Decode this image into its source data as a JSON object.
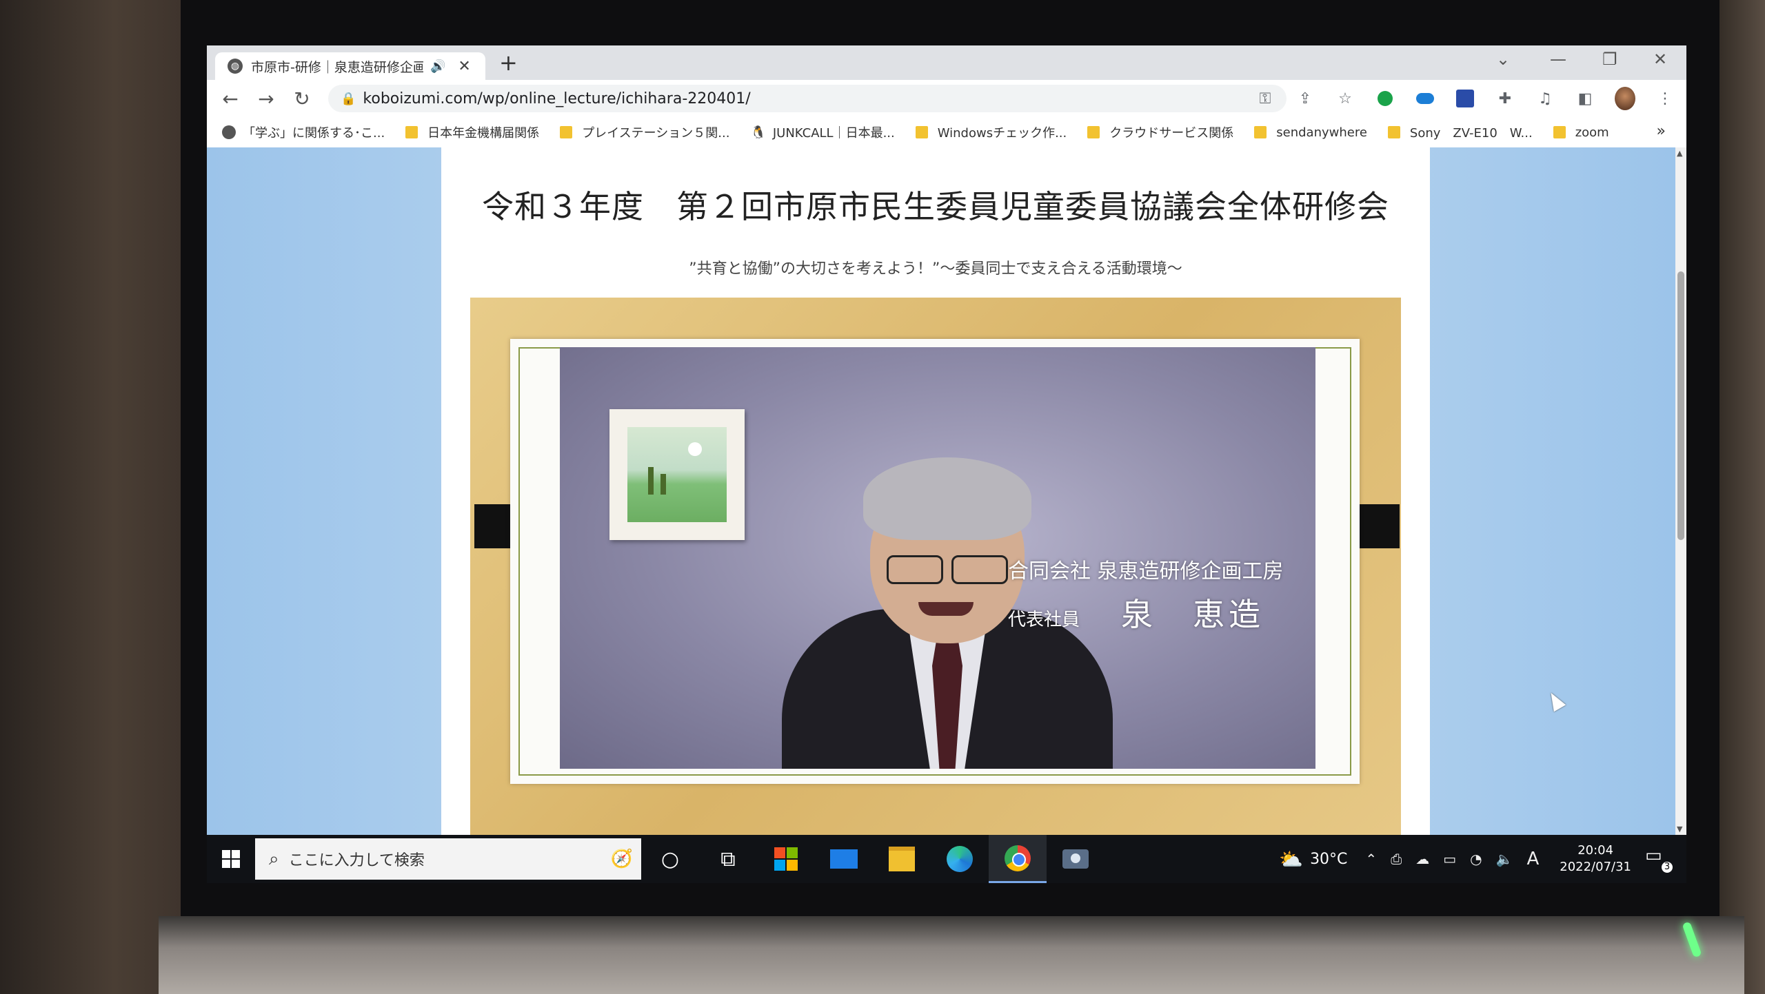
{
  "browser": {
    "tab_title": "市原市-研修｜泉恵造研修企画",
    "url": "koboizumi.com/wp/online_lecture/ichihara-220401/"
  },
  "bookmarks": [
    {
      "label": "「学ぶ」に関係する･こ...",
      "icon": "globe-icon"
    },
    {
      "label": "日本年金機構届関係",
      "icon": "folder-icon"
    },
    {
      "label": "プレイステーション５関...",
      "icon": "folder-icon"
    },
    {
      "label": "JUNKCALL｜日本最...",
      "icon": "bird-icon"
    },
    {
      "label": "Windowsチェック作...",
      "icon": "folder-icon"
    },
    {
      "label": "クラウドサービス関係",
      "icon": "folder-icon"
    },
    {
      "label": "sendanywhere",
      "icon": "folder-icon"
    },
    {
      "label": "Sony　ZV-E10　W...",
      "icon": "folder-icon"
    },
    {
      "label": "zoom",
      "icon": "folder-icon"
    }
  ],
  "page": {
    "title": "令和３年度　第２回市原市民生委員児童委員協議会全体研修会",
    "subtitle": "”共育と協働”の大切さを考えよう！”～委員同士で支え合える活動環境～"
  },
  "video": {
    "caption_company": "合同会社 泉恵造研修企画工房",
    "caption_role": "代表社員",
    "caption_name": "泉　恵造"
  },
  "taskbar": {
    "search_placeholder": "ここに入力して検索",
    "temperature": "30°C",
    "ime": "A",
    "time": "20:04",
    "date": "2022/07/31",
    "notifications": "3"
  }
}
